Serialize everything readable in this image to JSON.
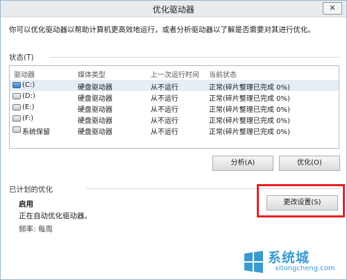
{
  "window": {
    "title": "优化驱动器",
    "close_label": "✕"
  },
  "description": "你可以优化驱动器以帮助计算机更高效地运行，或者分析驱动器以了解是否需要对其进行优化。",
  "status_section": {
    "label": "状态(T)"
  },
  "drives_table": {
    "columns": [
      "驱动器",
      "媒体类型",
      "上一次运行时间",
      "当前状态"
    ],
    "rows": [
      {
        "drive": "(C:)",
        "type": "硬盘驱动器",
        "last_run": "从不运行",
        "status": "正常(碎片整理已完成 0%)",
        "icon": "system-drive-icon",
        "selected": true
      },
      {
        "drive": "(D:)",
        "type": "硬盘驱动器",
        "last_run": "从不运行",
        "status": "正常(碎片整理已完成 0%)",
        "icon": "drive-icon",
        "selected": false
      },
      {
        "drive": "(E:)",
        "type": "硬盘驱动器",
        "last_run": "从不运行",
        "status": "正常(碎片整理已完成 0%)",
        "icon": "drive-icon",
        "selected": false
      },
      {
        "drive": "(F:)",
        "type": "硬盘驱动器",
        "last_run": "从不运行",
        "status": "正常(碎片整理已完成 0%)",
        "icon": "drive-icon",
        "selected": false
      },
      {
        "drive": "系统保留",
        "type": "硬盘驱动器",
        "last_run": "从不运行",
        "status": "正常(碎片整理已完成 0%)",
        "icon": "drive-icon",
        "selected": false
      }
    ]
  },
  "buttons": {
    "analyze": "分析(A)",
    "optimize": "优化(O)",
    "change_settings": "更改设置(S)"
  },
  "scheduled": {
    "label": "已计划的优化",
    "state": "启用",
    "detail": "正在自动优化驱动器。",
    "frequency": "频率: 每周"
  },
  "watermark": {
    "brand": "系统城",
    "url": "xitongcheng.com"
  },
  "colors": {
    "highlight_box": "#e8201f",
    "selected_row": "#e6eef5",
    "watermark": "#3a9ad0"
  }
}
